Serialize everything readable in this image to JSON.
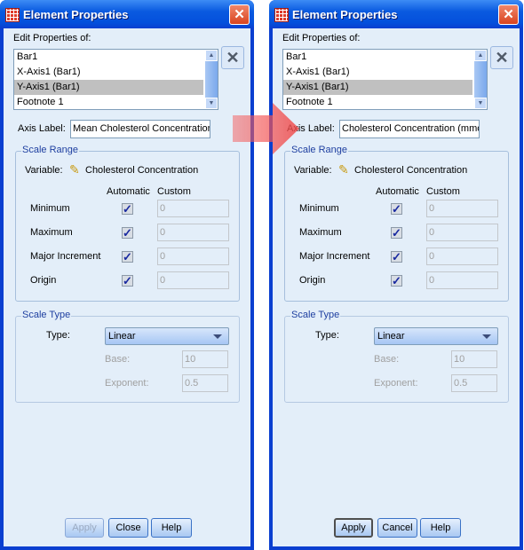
{
  "left": {
    "title": "Element Properties",
    "edit_label": "Edit Properties of:",
    "items": [
      "Bar1",
      "X-Axis1 (Bar1)",
      "Y-Axis1 (Bar1)",
      "Footnote 1"
    ],
    "selected_index": 2,
    "axis_label_label": "Axis Label:",
    "axis_label_value": "Mean Cholesterol Concentration",
    "scale_range": {
      "title": "Scale Range",
      "variable_label": "Variable:",
      "variable": "Cholesterol Concentration",
      "col_automatic": "Automatic",
      "col_custom": "Custom",
      "rows": [
        {
          "label": "Minimum",
          "automatic": true,
          "custom": "0"
        },
        {
          "label": "Maximum",
          "automatic": true,
          "custom": "0"
        },
        {
          "label": "Major Increment",
          "automatic": true,
          "custom": "0"
        },
        {
          "label": "Origin",
          "automatic": true,
          "custom": "0"
        }
      ]
    },
    "scale_type": {
      "title": "Scale Type",
      "type_label": "Type:",
      "type_value": "Linear",
      "base_label": "Base:",
      "base_value": "10",
      "exponent_label": "Exponent:",
      "exponent_value": "0.5"
    },
    "buttons": {
      "apply": "Apply",
      "close": "Close",
      "help": "Help"
    },
    "apply_enabled": false
  },
  "right": {
    "title": "Element Properties",
    "edit_label": "Edit Properties of:",
    "items": [
      "Bar1",
      "X-Axis1 (Bar1)",
      "Y-Axis1 (Bar1)",
      "Footnote 1"
    ],
    "selected_index": 2,
    "axis_label_label": "Axis Label:",
    "axis_label_value": "Cholesterol Concentration (mmol/L)",
    "scale_range": {
      "title": "Scale Range",
      "variable_label": "Variable:",
      "variable": "Cholesterol Concentration",
      "col_automatic": "Automatic",
      "col_custom": "Custom",
      "rows": [
        {
          "label": "Minimum",
          "automatic": true,
          "custom": "0"
        },
        {
          "label": "Maximum",
          "automatic": true,
          "custom": "0"
        },
        {
          "label": "Major Increment",
          "automatic": true,
          "custom": "0"
        },
        {
          "label": "Origin",
          "automatic": true,
          "custom": "0"
        }
      ]
    },
    "scale_type": {
      "title": "Scale Type",
      "type_label": "Type:",
      "type_value": "Linear",
      "base_label": "Base:",
      "base_value": "10",
      "exponent_label": "Exponent:",
      "exponent_value": "0.5"
    },
    "buttons": {
      "apply": "Apply",
      "close": "Cancel",
      "help": "Help"
    },
    "apply_enabled": true
  },
  "arrow_color": "#f04a4a"
}
